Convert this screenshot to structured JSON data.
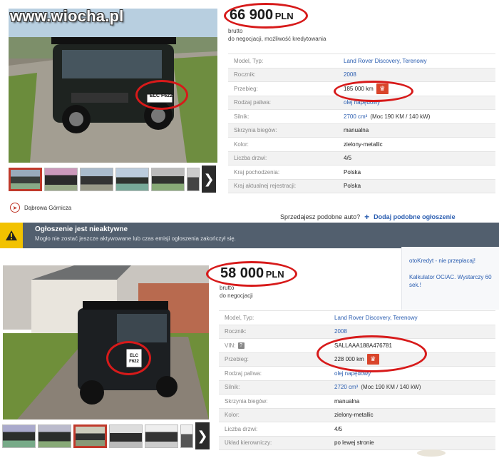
{
  "watermark": "www.wiocha.pl",
  "listing1": {
    "price_number": "66 900",
    "price_currency": "PLN",
    "price_note1": "brutto",
    "price_note2": "do negocjacji, możliwość kredytowania",
    "thumbnail_count": 6,
    "specs": [
      {
        "label": "Model, Typ:",
        "value": "Land Rover Discovery, Terenowy",
        "link": true
      },
      {
        "label": "Rocznik:",
        "value": "2008",
        "link": true
      },
      {
        "label": "Przebieg:",
        "value": "185 000 km",
        "link": false,
        "km_button": true
      },
      {
        "label": "Rodzaj paliwa:",
        "value": "olej napędowy",
        "link": true
      },
      {
        "label": "Silnik:",
        "value": "2700 cm³",
        "extra": "(Moc 190 KM / 140 kW)",
        "link": true
      },
      {
        "label": "Skrzynia biegów:",
        "value": "manualna",
        "link": false
      },
      {
        "label": "Kolor:",
        "value": "zielony-metallic",
        "link": false
      },
      {
        "label": "Liczba drzwi:",
        "value": "4/5",
        "link": false
      },
      {
        "label": "Kraj pochodzenia:",
        "value": "Polska",
        "link": false
      },
      {
        "label": "Kraj aktualnej rejestracji:",
        "value": "Polska",
        "link": false
      }
    ],
    "location": "Dąbrowa Górnicza",
    "cta_question": "Sprzedajesz podobne auto?",
    "cta_link": "Dodaj podobne ogłoszenie",
    "plate": "ELC F622"
  },
  "banner": {
    "title": "Ogłoszenie jest nieaktywne",
    "text": "Mogło nie zostać jeszcze aktywowane lub czas emisji ogłoszenia zakończył się."
  },
  "sidebox": {
    "line1": "otoKredyt - nie przepłacaj!",
    "line2": "Kalkulator OC/AC. Wystarczy 60 sek.!"
  },
  "listing2": {
    "price_number": "58 000",
    "price_currency": "PLN",
    "price_note1": "brutto",
    "price_note2": "do negocjacji",
    "specs": [
      {
        "label": "Model, Typ:",
        "value": "Land Rover Discovery, Terenowy",
        "link": true
      },
      {
        "label": "Rocznik:",
        "value": "2008",
        "link": true
      },
      {
        "label": "VIN:",
        "value": "SALLAAA188A476781",
        "link": false,
        "info": true
      },
      {
        "label": "Przebieg:",
        "value": "228 000 km",
        "link": false,
        "km_button": true
      },
      {
        "label": "Rodzaj paliwa:",
        "value": "olej napędowy",
        "link": true
      },
      {
        "label": "Silnik:",
        "value": "2720 cm³",
        "extra": "(Moc 190 KM / 140 kW)",
        "link": true
      },
      {
        "label": "Skrzynia biegów:",
        "value": "manualna",
        "link": false
      },
      {
        "label": "Kolor:",
        "value": "zielony-metallic",
        "link": false
      },
      {
        "label": "Liczba drzwi:",
        "value": "4/5",
        "link": false
      },
      {
        "label": "Układ kierowniczy:",
        "value": "po lewej stronie",
        "link": false
      }
    ],
    "plate": "ELC F622"
  },
  "colors": {
    "accent_red": "#d71a1a",
    "link_blue": "#2a5db0",
    "banner_bg": "#525f6e",
    "warning_yellow": "#f2c200"
  },
  "icons": {
    "arrow": "chevron-right-icon",
    "km": "car-icon",
    "location": "compass-icon",
    "warning": "warning-icon"
  }
}
